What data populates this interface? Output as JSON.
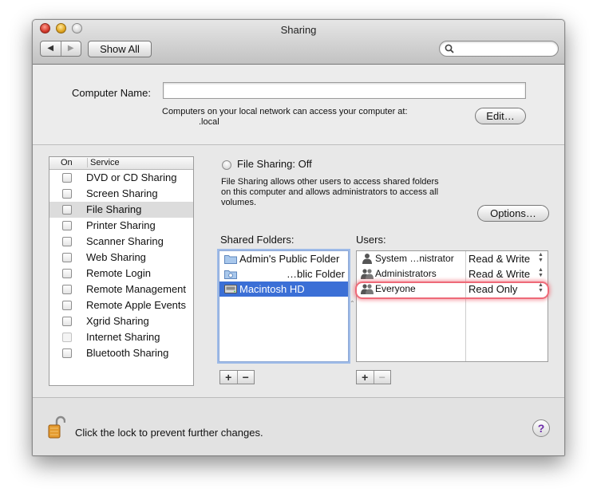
{
  "window": {
    "title": "Sharing"
  },
  "toolbar": {
    "back_label": "◀",
    "forward_label": "▶",
    "show_all_label": "Show All",
    "search_placeholder": ""
  },
  "computer_name": {
    "label": "Computer Name:",
    "value": "",
    "note": "Computers on your local network can access your computer at:",
    "local_address": ".local",
    "edit_label": "Edit…"
  },
  "services": {
    "header_on": "On",
    "header_service": "Service",
    "items": [
      {
        "label": "DVD or CD Sharing",
        "checked": false
      },
      {
        "label": "Screen Sharing",
        "checked": false
      },
      {
        "label": "File Sharing",
        "checked": false,
        "selected": true
      },
      {
        "label": "Printer Sharing",
        "checked": false
      },
      {
        "label": "Scanner Sharing",
        "checked": false
      },
      {
        "label": "Web Sharing",
        "checked": false
      },
      {
        "label": "Remote Login",
        "checked": false
      },
      {
        "label": "Remote Management",
        "checked": false
      },
      {
        "label": "Remote Apple Events",
        "checked": false
      },
      {
        "label": "Xgrid Sharing",
        "checked": false
      },
      {
        "label": "Internet Sharing",
        "checked": false,
        "disabled": true
      },
      {
        "label": "Bluetooth Sharing",
        "checked": false
      }
    ]
  },
  "file_sharing": {
    "status": "File Sharing: Off",
    "description_1": "File Sharing allows other users to access shared folders",
    "description_2": "on this computer and allows administrators to access all",
    "description_3": "volumes.",
    "options_label": "Options…",
    "shared_folders_label": "Shared Folders:",
    "users_label": "Users:",
    "folders": [
      {
        "label": "Admin's Public Folder",
        "icon": "folder-icon"
      },
      {
        "label": "…blic Folder",
        "icon": "public-folder-icon"
      },
      {
        "label": "Macintosh HD",
        "icon": "hard-drive-icon",
        "selected": true
      }
    ],
    "users": [
      {
        "name": "System …nistrator",
        "permission": "Read & Write",
        "icon": "user-icon"
      },
      {
        "name": "Administrators",
        "permission": "Read & Write",
        "icon": "group-icon"
      },
      {
        "name": "Everyone",
        "permission": "Read Only",
        "icon": "group-icon",
        "highlighted": true
      }
    ],
    "add_label": "+",
    "remove_label": "−"
  },
  "footer": {
    "lock_text": "Click the lock to prevent further changes.",
    "help_label": "?"
  },
  "colors": {
    "selection": "#3b6fd6",
    "highlight": "#ee6a78",
    "help": "#6b2aa8"
  }
}
